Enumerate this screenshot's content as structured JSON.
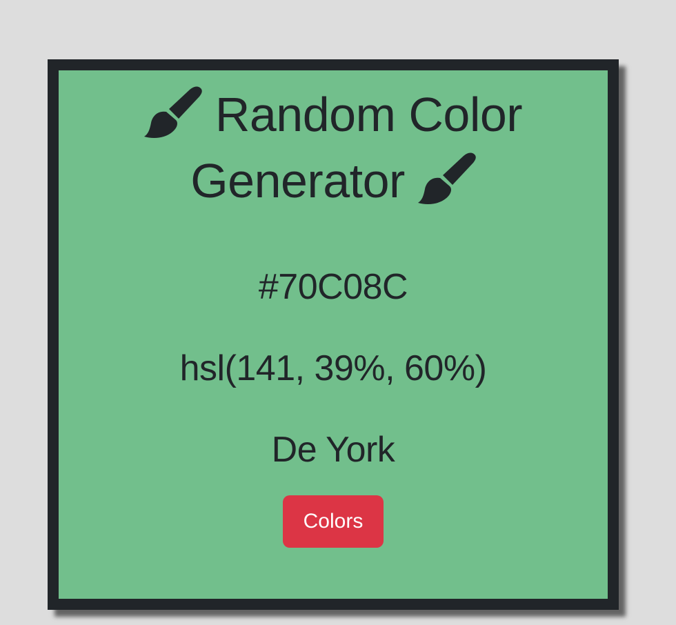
{
  "header": {
    "title_line1": "Random Color",
    "title_line2": "Generator",
    "icon": "paint-brush-icon"
  },
  "color": {
    "hex": "#70C08C",
    "hsl": "hsl(141, 39%, 60%)",
    "name": "De York"
  },
  "button": {
    "label": "Colors"
  },
  "colors": {
    "page_background": "#dddddd",
    "card_background": "#72bf8c",
    "card_border": "#212529",
    "button_background": "#dc3545",
    "text": "#212529"
  }
}
